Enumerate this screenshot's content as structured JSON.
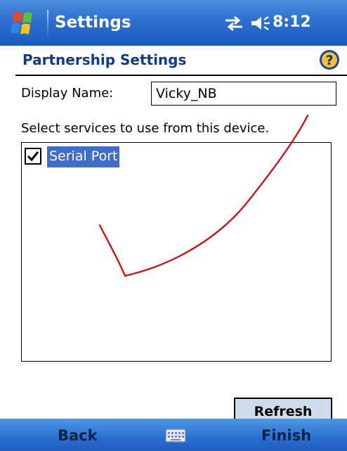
{
  "status_bar": {
    "app_title": "Settings",
    "time": "8:12",
    "icons": [
      "windows-logo-icon",
      "connectivity-icon",
      "volume-icon"
    ]
  },
  "page": {
    "title": "Partnership Settings",
    "help_icon": "help-icon"
  },
  "form": {
    "display_name_label": "Display Name:",
    "display_name_value": "Vicky_NB",
    "services_prompt": "Select services to use from this device.",
    "services": [
      {
        "label": "Serial Port",
        "checked": true,
        "selected": true
      }
    ],
    "refresh_label": "Refresh"
  },
  "softkeys": {
    "left": "Back",
    "center_icon": "keyboard-icon",
    "right": "Finish"
  },
  "colors": {
    "title_bar": "#2c6fd0",
    "page_title": "#0f3c8f",
    "selection": "#3f6ec9",
    "annotation_check": "#dd0000"
  }
}
